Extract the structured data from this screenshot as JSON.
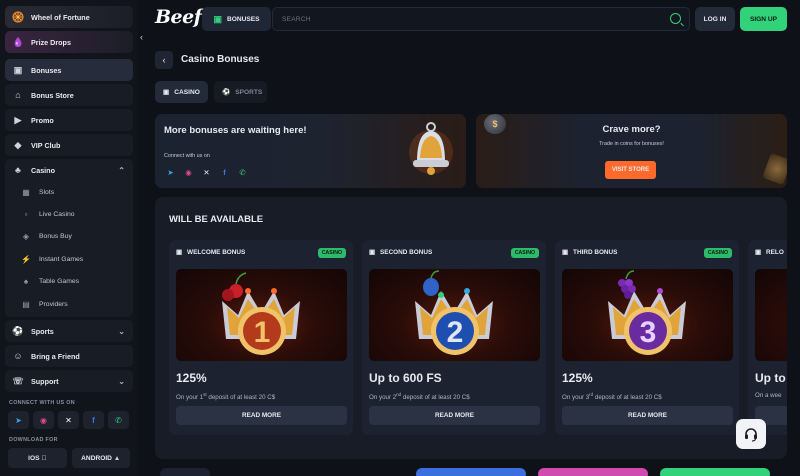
{
  "header": {
    "logo": "Beef",
    "bonuses_label": "BONUSES",
    "search_placeholder": "SEARCH",
    "login_label": "LOG IN",
    "signup_label": "SIGN UP"
  },
  "sidebar": {
    "featured": [
      {
        "label": "Wheel of Fortune",
        "icon": "wheel-icon"
      },
      {
        "label": "Prize Drops",
        "icon": "prize-drop-icon"
      }
    ],
    "items": [
      {
        "label": "Bonuses",
        "icon": "gift-icon"
      },
      {
        "label": "Bonus Store",
        "icon": "store-icon"
      },
      {
        "label": "Promo",
        "icon": "megaphone-icon"
      },
      {
        "label": "VIP Club",
        "icon": "diamond-icon"
      }
    ],
    "casino": {
      "label": "Casino",
      "children": [
        "Slots",
        "Live Casino",
        "Bonus Buy",
        "Instant Games",
        "Table Games",
        "Providers"
      ]
    },
    "sports_label": "Sports",
    "friend_label": "Bring a Friend",
    "support_label": "Support",
    "connect_label": "CONNECT WITH US ON",
    "download_label": "DOWNLOAD FOR",
    "ios_label": "IOS",
    "android_label": "ANDROID"
  },
  "main": {
    "title": "Casino Bonuses",
    "tabs": [
      {
        "label": "CASINO",
        "icon": "casino-chip-icon"
      },
      {
        "label": "SPORTS",
        "icon": "ball-icon"
      }
    ],
    "banner_left": {
      "title": "More bonuses are waiting here!",
      "connect": "Connect with us on"
    },
    "banner_right": {
      "title": "Crave more?",
      "subtitle": "Trade in coins for bonuses!",
      "button": "VISIT STORE"
    },
    "section_title": "WILL BE AVAILABLE",
    "cards": [
      {
        "title": "WELCOME BONUS",
        "badge": "CASINO",
        "number": "1",
        "amount": "125%",
        "desc_pre": "On your 1",
        "desc_sup": "st",
        "desc_post": " deposit of at least 20 C$",
        "button": "READ MORE",
        "fruit": "cherry"
      },
      {
        "title": "SECOND BONUS",
        "badge": "CASINO",
        "number": "2",
        "amount": "Up to 600 FS",
        "desc_pre": "On your 2",
        "desc_sup": "nd",
        "desc_post": " deposit of at least 20 C$",
        "button": "READ MORE",
        "fruit": "plum"
      },
      {
        "title": "THIRD BONUS",
        "badge": "CASINO",
        "number": "3",
        "amount": "125%",
        "desc_pre": "On your 3",
        "desc_sup": "rd",
        "desc_post": " deposit of at least 20 C$",
        "button": "READ MORE",
        "fruit": "grapes"
      },
      {
        "title": "RELO",
        "badge": "",
        "number": "",
        "amount": "Up to",
        "desc_pre": "On a wee",
        "desc_sup": "",
        "desc_post": "",
        "button": "",
        "fruit": ""
      }
    ]
  },
  "colors": {
    "accent_green": "#31d27a",
    "orange": "#ff6a2a",
    "background": "#0e1117"
  }
}
